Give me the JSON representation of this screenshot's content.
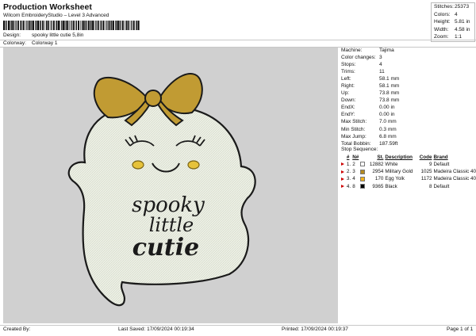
{
  "header": {
    "title": "Production Worksheet",
    "subtitle": "Wilcom EmbroideryStudio – Level 3 Advanced"
  },
  "stats": [
    {
      "label": "Stitches:",
      "value": "25373"
    },
    {
      "label": "Colors:",
      "value": "4"
    },
    {
      "label": "Height:",
      "value": "5.81 in"
    },
    {
      "label": "Width:",
      "value": "4.58 in"
    },
    {
      "label": "Zoom:",
      "value": "1:1"
    }
  ],
  "meta": {
    "design_label": "Design:",
    "design_value": "spooky little cutie 5,8in",
    "colorway_label": "Colorway:",
    "colorway_value": "Colorway 1"
  },
  "artwork": {
    "text_line1": "spooky",
    "text_line2": "little",
    "text_line3": "cutie"
  },
  "machine_info": [
    {
      "label": "Machine:",
      "value": "Tajima"
    },
    {
      "label": "Color changes:",
      "value": "3"
    },
    {
      "label": "Stops:",
      "value": "4"
    },
    {
      "label": "Trims:",
      "value": "11"
    },
    {
      "label": "Left:",
      "value": "58.1 mm"
    },
    {
      "label": "Right:",
      "value": "58.1 mm"
    },
    {
      "label": "Up:",
      "value": "73.8 mm"
    },
    {
      "label": "Down:",
      "value": "73.8 mm"
    },
    {
      "label": "EndX:",
      "value": "0.00 in"
    },
    {
      "label": "EndY:",
      "value": "0.00 in"
    },
    {
      "label": "Max Stitch:",
      "value": "7.0 mm"
    },
    {
      "label": "Min Stitch:",
      "value": "0.3 mm"
    },
    {
      "label": "Max Jump:",
      "value": "6.8 mm"
    },
    {
      "label": "Total Bobbin:",
      "value": "187.59ft"
    }
  ],
  "stop_sequence": {
    "title": "Stop Sequence:",
    "headers": {
      "n": "#",
      "n2": "N#",
      "st": "St.",
      "desc": "Description",
      "code": "Code",
      "brand": "Brand"
    },
    "rows": [
      {
        "stop": "1.",
        "needle": "2",
        "color": "#ffffff",
        "stitches": "12882",
        "description": "White",
        "code": "9",
        "brand": "Default"
      },
      {
        "stop": "2.",
        "needle": "3",
        "color": "#b58a1f",
        "stitches": "2954",
        "description": "Military Gold",
        "code": "1025",
        "brand": "Madeira Classic 40"
      },
      {
        "stop": "3.",
        "needle": "4",
        "color": "#f2b21a",
        "stitches": "170",
        "description": "Egg Yolk",
        "code": "1172",
        "brand": "Madeira Classic 40"
      },
      {
        "stop": "4.",
        "needle": "8",
        "color": "#000000",
        "stitches": "9365",
        "description": "Black",
        "code": "8",
        "brand": "Default"
      }
    ]
  },
  "footer": {
    "created_by": "Created By:",
    "last_saved": "Last Saved: 17/09/2024 00:19:34",
    "printed": "Printed: 17/09/2024 00:19:37",
    "page": "Page 1 of 1"
  }
}
